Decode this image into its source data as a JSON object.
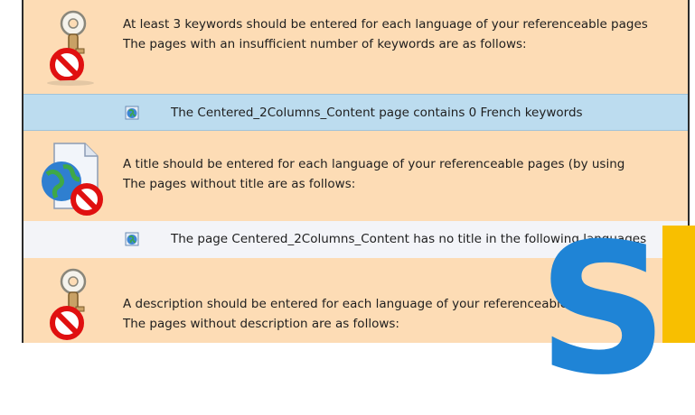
{
  "blocks": [
    {
      "icon": "key-forbidden-icon",
      "line1": "At least 3 keywords should be entered for each language of your referenceable pages",
      "line2": "The pages with an insufficient number of keywords are as follows:"
    },
    {
      "icon": "globe-document-forbidden-icon",
      "line1": "A title should be entered for each language of your referenceable pages (by using",
      "line2": "The pages without title are as follows:"
    },
    {
      "icon": "key-forbidden-icon",
      "line1": "A description should be entered for each language of your referenceable pages",
      "line2": "The pages without description are as follows:"
    }
  ],
  "rows": [
    {
      "icon": "globe-page-icon",
      "pre": "The ",
      "page": "Centered_2Columns_Content",
      "post": " page contains 0 French keywords"
    },
    {
      "icon": "globe-page-icon",
      "pre": "The page ",
      "page": "Centered_2Columns_Content",
      "post": " has no title in the following languages"
    }
  ],
  "watermark": {
    "icon": "s-logo-icon",
    "letter": "S"
  },
  "colors": {
    "block_bg": "#fddcb5",
    "row_highlight": "#bcdcef",
    "row_plain": "#f3f4f8",
    "logo_blue": "#1f84d6",
    "logo_yellow": "#f8bf00"
  }
}
